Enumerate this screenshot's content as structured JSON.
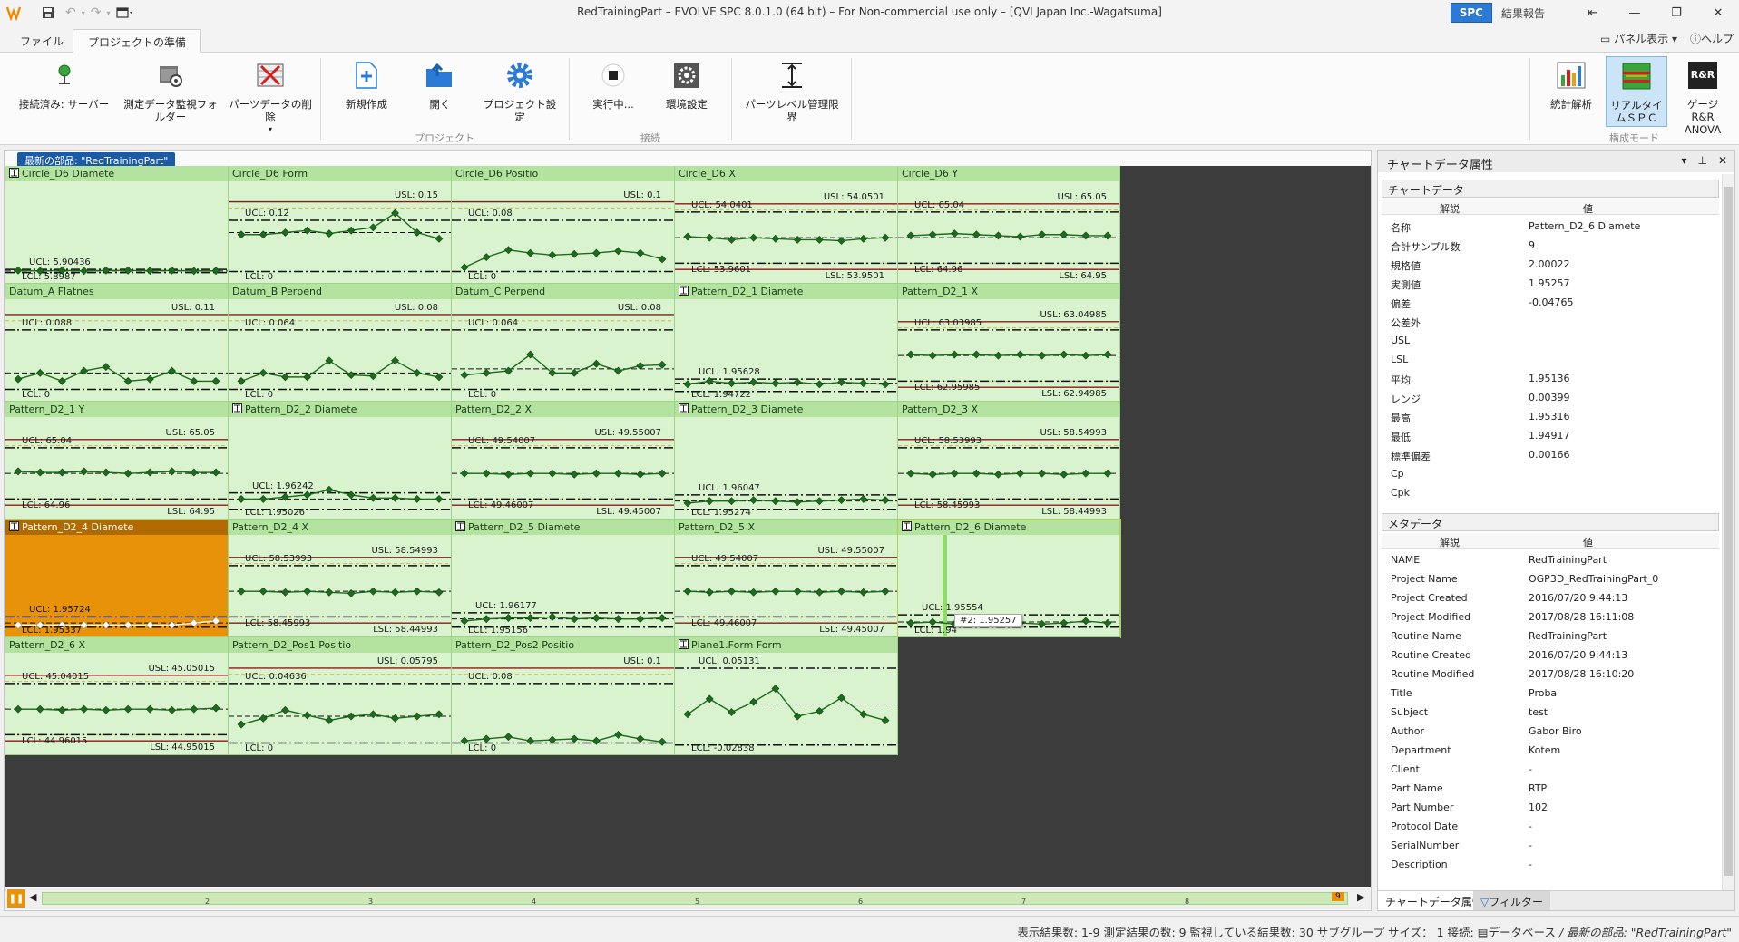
{
  "app": {
    "title": "RedTrainingPart – EVOLVE SPC 8.0.1.0 (64 bit) – For Non-commercial use only – [QVI Japan Inc.-Wagatsuma]",
    "badge": "SPC",
    "report_label": "結果報告",
    "panel_view": "パネル表示",
    "help": "ヘルプ"
  },
  "tabs": [
    {
      "label": "ファイル"
    },
    {
      "label": "プロジェクトの準備"
    }
  ],
  "ribbon": {
    "connected": "接続済み: サーバー",
    "monitor_folder": "測定データ監視フォルダー",
    "delete_part": "パーツデータの削除",
    "new_project": "新規作成",
    "open": "開く",
    "project_settings": "プロジェクト設定",
    "running": "実行中...",
    "env_settings": "環境設定",
    "part_limits": "パーツレベル管理限界",
    "group_project": "プロジェクト",
    "group_connection": "接続",
    "stats": "統計解析",
    "realtime_spc": "リアルタイムＳＰＣ",
    "gage_rr": "ゲージ R&R ANOVA",
    "rr_icon": "R&R",
    "group_mode": "構成モード"
  },
  "chart_area": {
    "part_label": "最新の部品: \"RedTrainingPart\"",
    "tooltip": "#2: 1.95257"
  },
  "chart_data": [
    {
      "type": "line",
      "title": "Circle_D6 Diamete",
      "hist": true,
      "lim": [
        {
          "key": "UCL",
          "v": "5.90436",
          "side": "l"
        },
        {
          "key": "LCL",
          "v": "5.8987",
          "side": "l"
        }
      ],
      "lines": {
        "usl": null,
        "ucl": 0.86,
        "cl": 0.875,
        "lcl": 0.89,
        "lsl": null
      },
      "y": [
        0.87,
        0.875,
        0.87,
        0.875,
        0.87,
        0.87,
        0.872,
        0.87,
        0.875,
        0.873
      ]
    },
    {
      "type": "line",
      "title": "Circle_D6 Form",
      "lim": [
        {
          "key": "USL",
          "v": "0.15",
          "side": "r"
        },
        {
          "key": "UCL",
          "v": "0.12",
          "side": "l"
        },
        {
          "key": "LCL",
          "v": "0",
          "side": "l"
        }
      ],
      "lines": {
        "usl": 0.2,
        "ucl": 0.38,
        "cl": 0.5,
        "lcl": 0.88,
        "lsl": null
      },
      "y": [
        0.52,
        0.52,
        0.5,
        0.48,
        0.51,
        0.48,
        0.45,
        0.31,
        0.5,
        0.56
      ]
    },
    {
      "type": "line",
      "title": "Circle_D6 Positio",
      "lim": [
        {
          "key": "USL",
          "v": "0.1",
          "side": "r"
        },
        {
          "key": "UCL",
          "v": "0.08",
          "side": "l"
        },
        {
          "key": "LCL",
          "v": "0",
          "side": "l"
        }
      ],
      "lines": {
        "usl": 0.2,
        "ucl": 0.38,
        "cl": null,
        "lcl": 0.88,
        "lsl": null
      },
      "y": [
        0.84,
        0.74,
        0.67,
        0.7,
        0.72,
        0.71,
        0.7,
        0.68,
        0.7,
        0.76
      ]
    },
    {
      "type": "line",
      "title": "Circle_D6 X",
      "lim": [
        {
          "key": "UCL",
          "v": "54.0401",
          "side": "l"
        },
        {
          "key": "USL",
          "v": "54.0501",
          "side": "r"
        },
        {
          "key": "LCL",
          "v": "53.9601",
          "side": "l"
        },
        {
          "key": "LSL",
          "v": "53.9501",
          "side": "r"
        }
      ],
      "lines": {
        "usl": 0.22,
        "ucl": 0.3,
        "cl": 0.55,
        "lcl": 0.8,
        "lsl": 0.86
      },
      "y": [
        0.54,
        0.55,
        0.57,
        0.55,
        0.56,
        0.57,
        0.57,
        0.58,
        0.56,
        0.55
      ]
    },
    {
      "type": "line",
      "title": "Circle_D6 Y",
      "lim": [
        {
          "key": "UCL",
          "v": "65.04",
          "side": "l"
        },
        {
          "key": "USL",
          "v": "65.05",
          "side": "r"
        },
        {
          "key": "LCL",
          "v": "64.96",
          "side": "l"
        },
        {
          "key": "LSL",
          "v": "64.95",
          "side": "r"
        }
      ],
      "lines": {
        "usl": 0.22,
        "ucl": 0.3,
        "cl": 0.55,
        "lcl": 0.8,
        "lsl": 0.86
      },
      "y": [
        0.53,
        0.52,
        0.51,
        0.52,
        0.53,
        0.54,
        0.52,
        0.52,
        0.53,
        0.53
      ]
    },
    {
      "type": "line",
      "title": "Datum_A Flatnes",
      "lim": [
        {
          "key": "USL",
          "v": "0.11",
          "side": "r"
        },
        {
          "key": "UCL",
          "v": "0.088",
          "side": "l"
        },
        {
          "key": "LCL",
          "v": "0",
          "side": "l"
        }
      ],
      "lines": {
        "usl": 0.15,
        "ucl": 0.3,
        "cl": 0.72,
        "lcl": 0.88,
        "lsl": null
      },
      "y": [
        0.78,
        0.72,
        0.8,
        0.7,
        0.66,
        0.8,
        0.78,
        0.7,
        0.8,
        0.8
      ]
    },
    {
      "type": "line",
      "title": "Datum_B Perpend",
      "lim": [
        {
          "key": "USL",
          "v": "0.08",
          "side": "r"
        },
        {
          "key": "UCL",
          "v": "0.064",
          "side": "l"
        },
        {
          "key": "LCL",
          "v": "0",
          "side": "l"
        }
      ],
      "lines": {
        "usl": 0.15,
        "ucl": 0.3,
        "cl": 0.72,
        "lcl": 0.88,
        "lsl": null
      },
      "y": [
        0.8,
        0.72,
        0.76,
        0.76,
        0.6,
        0.74,
        0.75,
        0.6,
        0.72,
        0.76
      ]
    },
    {
      "type": "line",
      "title": "Datum_C Perpend",
      "lim": [
        {
          "key": "USL",
          "v": "0.08",
          "side": "r"
        },
        {
          "key": "UCL",
          "v": "0.064",
          "side": "l"
        },
        {
          "key": "LCL",
          "v": "0",
          "side": "l"
        }
      ],
      "lines": {
        "usl": 0.15,
        "ucl": 0.3,
        "cl": 0.68,
        "lcl": 0.88,
        "lsl": null
      },
      "y": [
        0.74,
        0.72,
        0.7,
        0.54,
        0.72,
        0.72,
        0.63,
        0.7,
        0.65,
        0.64
      ]
    },
    {
      "type": "line",
      "title": "Pattern_D2_1 Diamete",
      "hist": true,
      "lim": [
        {
          "key": "UCL",
          "v": "1.95628",
          "side": "l"
        },
        {
          "key": "LCL",
          "v": "1.94722",
          "side": "l"
        }
      ],
      "lines": {
        "usl": null,
        "ucl": 0.78,
        "cl": 0.82,
        "lcl": 0.9,
        "lsl": null
      },
      "y": [
        0.83,
        0.8,
        0.82,
        0.81,
        0.82,
        0.81,
        0.83,
        0.81,
        0.82,
        0.83
      ]
    },
    {
      "type": "line",
      "title": "Pattern_D2_1 X",
      "lim": [
        {
          "key": "UCL",
          "v": "63.03985",
          "side": "l"
        },
        {
          "key": "USL",
          "v": "63.04985",
          "side": "r"
        },
        {
          "key": "LCL",
          "v": "62.95985",
          "side": "l"
        },
        {
          "key": "LSL",
          "v": "62.94985",
          "side": "r"
        }
      ],
      "lines": {
        "usl": 0.22,
        "ucl": 0.3,
        "cl": 0.55,
        "lcl": 0.8,
        "lsl": 0.86
      },
      "y": [
        0.54,
        0.55,
        0.54,
        0.54,
        0.55,
        0.54,
        0.55,
        0.54,
        0.55,
        0.54
      ]
    },
    {
      "type": "line",
      "title": "Pattern_D2_1 Y",
      "lim": [
        {
          "key": "UCL",
          "v": "65.04",
          "side": "l"
        },
        {
          "key": "USL",
          "v": "65.05",
          "side": "r"
        },
        {
          "key": "LCL",
          "v": "64.96",
          "side": "l"
        },
        {
          "key": "LSL",
          "v": "64.95",
          "side": "r"
        }
      ],
      "lines": {
        "usl": 0.22,
        "ucl": 0.3,
        "cl": 0.55,
        "lcl": 0.8,
        "lsl": 0.86
      },
      "y": [
        0.53,
        0.54,
        0.54,
        0.53,
        0.54,
        0.55,
        0.54,
        0.53,
        0.54,
        0.54
      ]
    },
    {
      "type": "line",
      "title": "Pattern_D2_2 Diamete",
      "hist": true,
      "lim": [
        {
          "key": "UCL",
          "v": "1.96242",
          "side": "l"
        },
        {
          "key": "LCL",
          "v": "1.95026",
          "side": "l"
        }
      ],
      "lines": {
        "usl": null,
        "ucl": 0.74,
        "cl": 0.8,
        "lcl": 0.9,
        "lsl": null
      },
      "y": [
        0.8,
        0.8,
        0.78,
        0.76,
        0.71,
        0.76,
        0.79,
        0.79,
        0.8,
        0.8
      ]
    },
    {
      "type": "line",
      "title": "Pattern_D2_2 X",
      "lim": [
        {
          "key": "UCL",
          "v": "49.54007",
          "side": "l"
        },
        {
          "key": "USL",
          "v": "49.55007",
          "side": "r"
        },
        {
          "key": "LCL",
          "v": "49.46007",
          "side": "l"
        },
        {
          "key": "LSL",
          "v": "49.45007",
          "side": "r"
        }
      ],
      "lines": {
        "usl": 0.22,
        "ucl": 0.3,
        "cl": 0.55,
        "lcl": 0.8,
        "lsl": 0.86
      },
      "y": [
        0.55,
        0.55,
        0.56,
        0.55,
        0.55,
        0.56,
        0.55,
        0.55,
        0.56,
        0.55
      ]
    },
    {
      "type": "line",
      "title": "Pattern_D2_3 Diamete",
      "hist": true,
      "lim": [
        {
          "key": "UCL",
          "v": "1.96047",
          "side": "l"
        },
        {
          "key": "LCL",
          "v": "1.95274",
          "side": "l"
        }
      ],
      "lines": {
        "usl": null,
        "ucl": 0.76,
        "cl": 0.82,
        "lcl": 0.9,
        "lsl": null
      },
      "y": [
        0.84,
        0.82,
        0.82,
        0.81,
        0.82,
        0.83,
        0.82,
        0.81,
        0.8,
        0.81
      ]
    },
    {
      "type": "line",
      "title": "Pattern_D2_3 X",
      "lim": [
        {
          "key": "UCL",
          "v": "58.53993",
          "side": "l"
        },
        {
          "key": "USL",
          "v": "58.54993",
          "side": "r"
        },
        {
          "key": "LCL",
          "v": "58.45993",
          "side": "l"
        },
        {
          "key": "LSL",
          "v": "58.44993",
          "side": "r"
        }
      ],
      "lines": {
        "usl": 0.22,
        "ucl": 0.3,
        "cl": 0.55,
        "lcl": 0.8,
        "lsl": 0.86
      },
      "y": [
        0.55,
        0.56,
        0.55,
        0.55,
        0.56,
        0.55,
        0.55,
        0.56,
        0.55,
        0.55
      ]
    },
    {
      "type": "line",
      "title": "Pattern_D2_4 Diamete",
      "hist": true,
      "selected": true,
      "lim": [
        {
          "key": "UCL",
          "v": "1.95724",
          "side": "l"
        },
        {
          "key": "LCL",
          "v": "1.95337",
          "side": "l"
        }
      ],
      "lines": {
        "usl": null,
        "ucl": 0.8,
        "cl": 0.86,
        "lcl": 0.9,
        "lsl": null
      },
      "y": [
        0.88,
        0.88,
        0.88,
        0.88,
        0.88,
        0.88,
        0.88,
        0.88,
        0.86,
        0.84
      ],
      "white": true
    },
    {
      "type": "line",
      "title": "Pattern_D2_4 X",
      "lim": [
        {
          "key": "UCL",
          "v": "58.53993",
          "side": "l"
        },
        {
          "key": "USL",
          "v": "58.54993",
          "side": "r"
        },
        {
          "key": "LCL",
          "v": "58.45993",
          "side": "l"
        },
        {
          "key": "LSL",
          "v": "58.44993",
          "side": "r"
        }
      ],
      "lines": {
        "usl": 0.22,
        "ucl": 0.3,
        "cl": 0.55,
        "lcl": 0.8,
        "lsl": 0.86
      },
      "y": [
        0.55,
        0.55,
        0.56,
        0.55,
        0.56,
        0.57,
        0.55,
        0.56,
        0.55,
        0.56
      ]
    },
    {
      "type": "line",
      "title": "Pattern_D2_5 Diamete",
      "hist": true,
      "lim": [
        {
          "key": "UCL",
          "v": "1.96177",
          "side": "l"
        },
        {
          "key": "LCL",
          "v": "1.95156",
          "side": "l"
        }
      ],
      "lines": {
        "usl": null,
        "ucl": 0.76,
        "cl": 0.82,
        "lcl": 0.9,
        "lsl": null
      },
      "y": [
        0.84,
        0.82,
        0.81,
        0.81,
        0.8,
        0.82,
        0.81,
        0.82,
        0.82,
        0.81
      ]
    },
    {
      "type": "line",
      "title": "Pattern_D2_5 X",
      "lim": [
        {
          "key": "UCL",
          "v": "49.54007",
          "side": "l"
        },
        {
          "key": "USL",
          "v": "49.55007",
          "side": "r"
        },
        {
          "key": "LCL",
          "v": "49.46007",
          "side": "l"
        },
        {
          "key": "LSL",
          "v": "49.45007",
          "side": "r"
        }
      ],
      "lines": {
        "usl": 0.22,
        "ucl": 0.3,
        "cl": 0.55,
        "lcl": 0.8,
        "lsl": 0.86
      },
      "y": [
        0.55,
        0.56,
        0.55,
        0.56,
        0.55,
        0.55,
        0.56,
        0.55,
        0.56,
        0.55
      ]
    },
    {
      "type": "line",
      "title": "Pattern_D2_6 Diamete",
      "hist": true,
      "highlight": true,
      "lim": [
        {
          "key": "UCL",
          "v": "1.95554",
          "side": "l"
        },
        {
          "key": "LCL",
          "v": "1.94",
          "side": "l"
        }
      ],
      "lines": {
        "usl": null,
        "ucl": 0.78,
        "cl": 0.85,
        "lcl": 0.9,
        "lsl": null
      },
      "y": [
        0.86,
        0.85,
        0.87,
        0.86,
        0.85,
        0.86,
        0.87,
        0.86,
        0.84,
        0.86
      ]
    },
    {
      "type": "line",
      "title": "Pattern_D2_6 X",
      "lim": [
        {
          "key": "UCL",
          "v": "45.04015",
          "side": "l"
        },
        {
          "key": "USL",
          "v": "45.05015",
          "side": "r"
        },
        {
          "key": "LCL",
          "v": "44.96015",
          "side": "l"
        },
        {
          "key": "LSL",
          "v": "44.95015",
          "side": "r"
        }
      ],
      "lines": {
        "usl": 0.22,
        "ucl": 0.3,
        "cl": 0.55,
        "lcl": 0.8,
        "lsl": 0.86
      },
      "y": [
        0.55,
        0.55,
        0.56,
        0.55,
        0.56,
        0.55,
        0.55,
        0.56,
        0.55,
        0.54
      ]
    },
    {
      "type": "line",
      "title": "Pattern_D2_Pos1 Positio",
      "lim": [
        {
          "key": "USL",
          "v": "0.05795",
          "side": "r"
        },
        {
          "key": "UCL",
          "v": "0.04636",
          "side": "l"
        },
        {
          "key": "LCL",
          "v": "0",
          "side": "l"
        }
      ],
      "lines": {
        "usl": 0.15,
        "ucl": 0.3,
        "cl": 0.62,
        "lcl": 0.88,
        "lsl": null
      },
      "y": [
        0.7,
        0.64,
        0.56,
        0.61,
        0.66,
        0.62,
        0.6,
        0.64,
        0.62,
        0.6
      ]
    },
    {
      "type": "line",
      "title": "Pattern_D2_Pos2 Positio",
      "lim": [
        {
          "key": "USL",
          "v": "0.1",
          "side": "r"
        },
        {
          "key": "UCL",
          "v": "0.08",
          "side": "l"
        },
        {
          "key": "LCL",
          "v": "0",
          "side": "l"
        }
      ],
      "lines": {
        "usl": 0.15,
        "ucl": 0.3,
        "cl": null,
        "lcl": 0.88,
        "lsl": null
      },
      "y": [
        0.86,
        0.84,
        0.82,
        0.86,
        0.85,
        0.84,
        0.86,
        0.8,
        0.84,
        0.87
      ]
    },
    {
      "type": "line",
      "title": "Plane1.Form Form",
      "hist": true,
      "lim": [
        {
          "key": "UCL",
          "v": "0.05131",
          "side": "l"
        },
        {
          "key": "LCL",
          "v": "-0.02838",
          "side": "l"
        }
      ],
      "lines": {
        "usl": null,
        "ucl": 0.15,
        "cl": 0.5,
        "lcl": 0.9,
        "lsl": null
      },
      "y": [
        0.6,
        0.45,
        0.58,
        0.48,
        0.35,
        0.62,
        0.57,
        0.44,
        0.6,
        0.66
      ]
    }
  ],
  "timeline": {
    "ticks": [
      "2",
      "3",
      "4",
      "5",
      "6",
      "7",
      "8"
    ],
    "badge": "9"
  },
  "right_panel": {
    "title": "チャートデータ属性",
    "chart_section": "チャートデータ",
    "meta_section": "メタデータ",
    "col_desc": "解説",
    "col_val": "値",
    "chart_rows": [
      {
        "k": "名称",
        "v": "Pattern_D2_6 Diamete"
      },
      {
        "k": "合計サンプル数",
        "v": "9"
      },
      {
        "k": "規格値",
        "v": "2.00022"
      },
      {
        "k": "実測値",
        "v": "1.95257"
      },
      {
        "k": "偏差",
        "v": "-0.04765"
      },
      {
        "k": "公差外",
        "v": ""
      },
      {
        "k": "USL",
        "v": ""
      },
      {
        "k": "LSL",
        "v": ""
      },
      {
        "k": "平均",
        "v": "1.95136"
      },
      {
        "k": "レンジ",
        "v": "0.00399"
      },
      {
        "k": "最高",
        "v": "1.95316"
      },
      {
        "k": "最低",
        "v": "1.94917"
      },
      {
        "k": "標準偏差",
        "v": "0.00166"
      },
      {
        "k": "Cp",
        "v": ""
      },
      {
        "k": "Cpk",
        "v": ""
      }
    ],
    "meta_rows": [
      {
        "k": "NAME",
        "v": "RedTrainingPart"
      },
      {
        "k": "Project Name",
        "v": "OGP3D_RedTrainingPart_0"
      },
      {
        "k": "Project Created",
        "v": "2016/07/20 9:44:13"
      },
      {
        "k": "Project Modified",
        "v": "2017/08/28 16:11:08"
      },
      {
        "k": "Routine Name",
        "v": "RedTrainingPart"
      },
      {
        "k": "Routine Created",
        "v": "2016/07/20 9:44:13"
      },
      {
        "k": "Routine Modified",
        "v": "2017/08/28 16:10:20"
      },
      {
        "k": "Title",
        "v": "Proba"
      },
      {
        "k": "Subject",
        "v": "test"
      },
      {
        "k": "Author",
        "v": "Gabor Biro"
      },
      {
        "k": "Department",
        "v": "Kotem"
      },
      {
        "k": "Client",
        "v": "-"
      },
      {
        "k": "Part Name",
        "v": "RTP"
      },
      {
        "k": "Part Number",
        "v": "102"
      },
      {
        "k": "Protocol Date",
        "v": "-"
      },
      {
        "k": "SerialNumber",
        "v": "-"
      },
      {
        "k": "Description",
        "v": "-"
      }
    ],
    "tab_attrs": "チャートデータ属性",
    "tab_filter": "フィルター"
  },
  "status": {
    "text": "表示結果数: 1-9 測定結果の数: 9    監視している結果数: 30    サブグループ サイズ： 1    接続:",
    "db": "データベース",
    "latest": "/ 最新の部品: \"RedTrainingPart\""
  },
  "colors": {
    "accent": "#2b7bd6",
    "cell_bg": "#d8f3cd",
    "cell_header": "#b3e39f",
    "selected": "#e8920a",
    "spec_line": "#8b1a1a",
    "point": "#1e6a1e"
  }
}
